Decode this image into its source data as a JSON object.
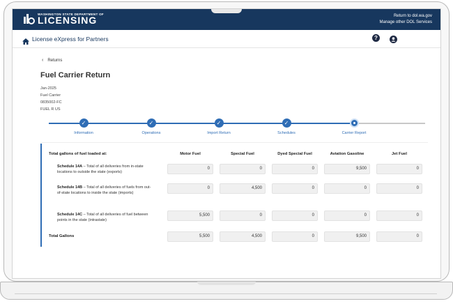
{
  "banner": {
    "brand_small": "WASHINGTON STATE DEPARTMENT OF",
    "brand_big": "LICENSING",
    "link_1": "Return to dol.wa.gov",
    "link_2": "Manage other DOL Services"
  },
  "appbar": {
    "title": "License eXpress for Partners"
  },
  "nav": {
    "back_label": "Returns"
  },
  "page": {
    "title": "Fuel Carrier Return",
    "meta": [
      "Jan-2025",
      "Fuel Carrier",
      "0835002-FC",
      "FUEL R US"
    ]
  },
  "steps": [
    {
      "label": "Information",
      "status": "done"
    },
    {
      "label": "Operations",
      "status": "done"
    },
    {
      "label": "Import Return",
      "status": "done"
    },
    {
      "label": "Schedules",
      "status": "done"
    },
    {
      "label": "Carrier Report",
      "status": "current"
    }
  ],
  "table": {
    "heading": "Total gallons of fuel loaded at:",
    "columns": [
      "Motor Fuel",
      "Special Fuel",
      "Dyed Special Fuel",
      "Aviation Gasoline",
      "Jet Fuel"
    ],
    "rows": [
      {
        "name": "Schedule 14A",
        "desc": " – Total of all deliveries from in-state locations to outside the state (exports)",
        "values": [
          "0",
          "0",
          "0",
          "9,500",
          "0"
        ]
      },
      {
        "name": "Schedule 14B",
        "desc": " – Total of all deliveries of fuels from out-of-state locations to inside the state (imports)",
        "values": [
          "0",
          "4,500",
          "0",
          "0",
          "0"
        ]
      },
      {
        "name": "Schedule 14C",
        "desc": " – Total of all deliveries of fuel between points in the state (intrastate)",
        "values": [
          "5,500",
          "0",
          "0",
          "0",
          "0"
        ]
      }
    ],
    "total_label": "Total Gallons",
    "total_values": [
      "5,500",
      "4,500",
      "0",
      "9,500",
      "0"
    ]
  },
  "colors": {
    "banner": "#17375e",
    "accent": "#2f6db5"
  }
}
